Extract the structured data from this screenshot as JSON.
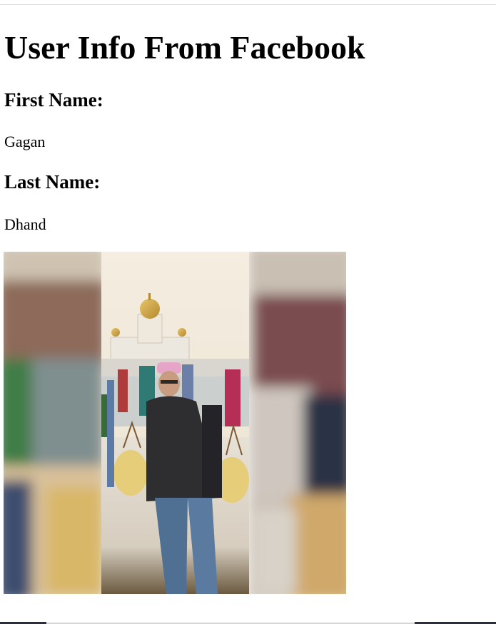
{
  "page": {
    "title": "User Info From Facebook"
  },
  "fields": {
    "first_name_label": "First Name:",
    "first_name_value": "Gagan",
    "last_name_label": "Last Name:",
    "last_name_value": "Dhand"
  },
  "photo": {
    "icon": "profile-picture"
  }
}
